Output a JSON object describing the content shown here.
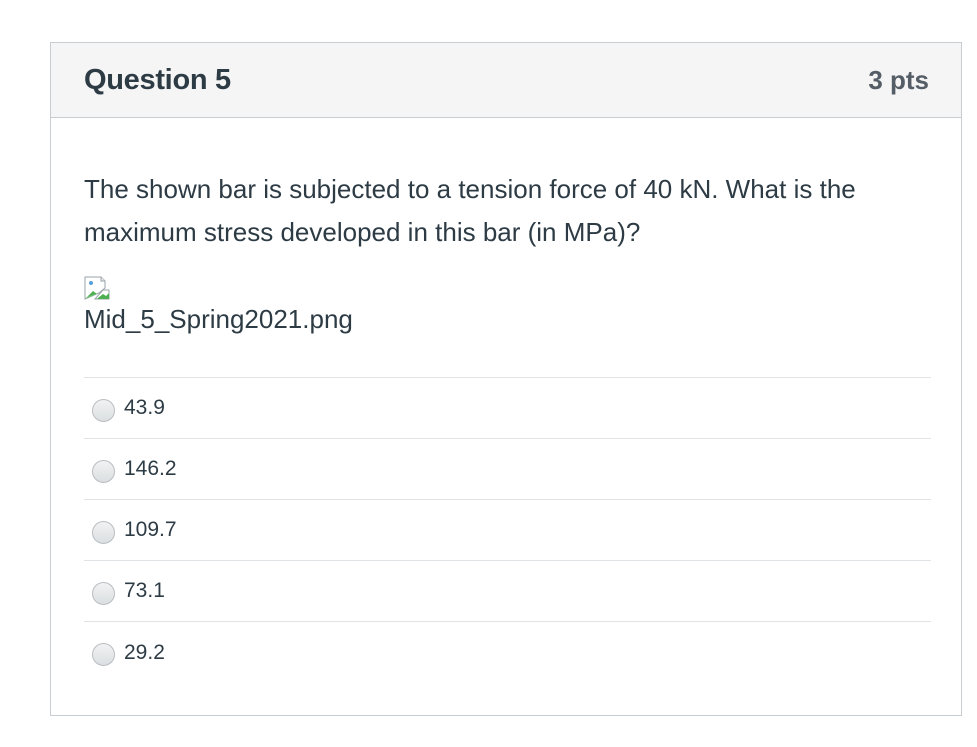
{
  "question": {
    "title": "Question 5",
    "points": "3 pts",
    "text": "The shown bar is subjected to a tension force of 40 kN. What is the maximum stress developed in this bar (in MPa)?",
    "image_filename": "Mid_5_Spring2021.png",
    "image_icon": "broken-image-icon"
  },
  "answers": [
    {
      "label": "43.9"
    },
    {
      "label": "146.2"
    },
    {
      "label": "109.7"
    },
    {
      "label": "73.1"
    },
    {
      "label": "29.2"
    }
  ]
}
